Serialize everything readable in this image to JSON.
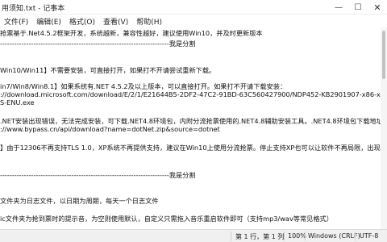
{
  "window": {
    "title": "用须知.txt - 记事本"
  },
  "menu": {
    "file": "文件(F)",
    "edit": "编辑(E)",
    "format": "格式(O)",
    "view": "查看(V)",
    "help": "帮助(H)"
  },
  "editor": {
    "lines": [
      "抢票基于.Net4.5.2框架开发，系统越新，兼容性越好，建议使用Win10，并及时更新版本",
      "",
      "-----------------------------------------------------------------------我是分割",
      "",
      "",
      "Win10/Win11】不需要安装，可直接打开，如果打不开请尝试重新下载。",
      "",
      "in7/Win8/Win8.1】如果系统有.NET 4.5.2及以上版本，可以直接打开。如果打不开请下载安装：",
      "://download.microsoft.com/download/E/2/1/E21644B5-2DF2-47C2-91BD-63C560427900/NDP452-KB2901907-x86-x64-",
      "S-ENU.exe",
      "",
      ".NET安装出现错误，无法完成安装，可下载.NET4.8环境包，内附分流抢票使用的.NET4.8辅助安装工具。.NET4.8环境包下载地址:",
      "://www.bypass.cn/api/download?name=dotNet.zip&source=dotnet",
      "",
      "】由于12306不再支持TLS 1.0，XP系统不再提供支持，建议在Win10上使用分流抢票。停止支持XP也可以让软件不再局限，出现更多的可",
      "",
      "",
      "-----------------------------------------------------------------------我是分割",
      "",
      "",
      "文件夹为日志文件，以日期为周期，每天一个日志文件",
      "",
      "ic文件夹为抢到票时的提示音，为空则使用默认，自定义只需拖入音乐重启软件即可（支持mp3/wav等常见格式）"
    ]
  },
  "status": {
    "position": "第 1 行，第 1 列",
    "zoom": "100%",
    "eol": "Windows (CRLF)",
    "encoding": "UTF-8"
  },
  "icons": {
    "minimize": "minimize-icon",
    "maximize": "maximize-icon",
    "close": "close-icon"
  }
}
